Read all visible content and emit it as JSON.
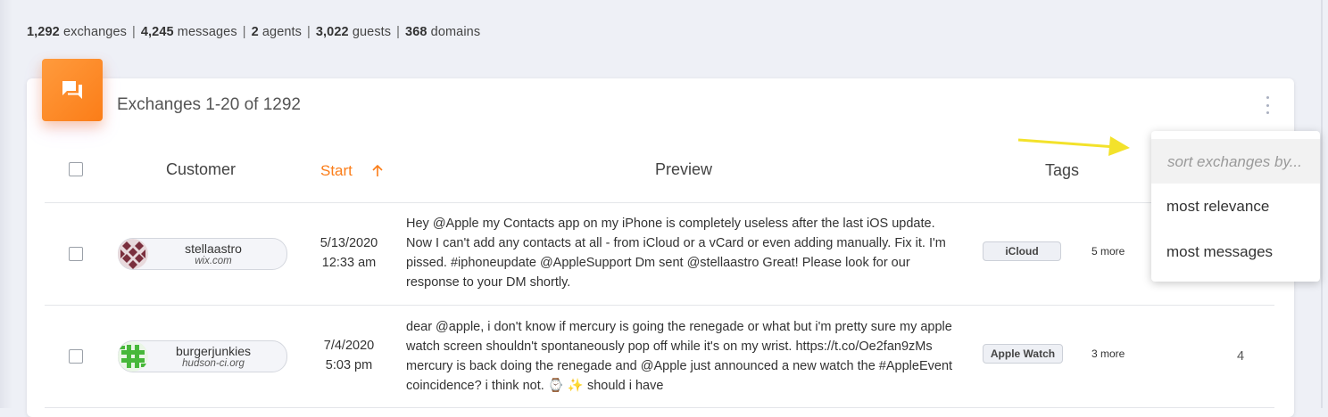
{
  "stats": {
    "exchanges_value": "1,292",
    "exchanges_label": "exchanges",
    "messages_value": "4,245",
    "messages_label": "messages",
    "agents_value": "2",
    "agents_label": "agents",
    "guests_value": "3,022",
    "guests_label": "guests",
    "domains_value": "368",
    "domains_label": "domains",
    "separator": "|"
  },
  "card": {
    "badge_icon": "chat-bubbles-icon",
    "title": "Exchanges 1-20 of 1292",
    "menu_icon": "kebab-menu-icon"
  },
  "table": {
    "headers": {
      "customer": "Customer",
      "start": "Start",
      "start_sort_icon": "arrow-up-icon",
      "preview": "Preview",
      "tags": "Tags"
    },
    "rows": [
      {
        "customer_name": "stellaastro",
        "customer_domain": "wix.com",
        "date": "5/13/2020",
        "time": "12:33 am",
        "preview": "Hey @Apple my Contacts app on my iPhone is completely useless after the last iOS update. Now I can't add any contacts at all - from iCloud or a vCard or even adding manually. Fix it. I'm pissed. #iphoneupdate @AppleSupport Dm sent @stellaastro Great! Please look for our response to your DM shortly.",
        "tag": "iCloud",
        "more": "5 more",
        "count": ""
      },
      {
        "customer_name": "burgerjunkies",
        "customer_domain": "hudson-ci.org",
        "date": "7/4/2020",
        "time": "5:03 pm",
        "preview": "dear @apple, i don't know if mercury is going the renegade or what but i'm pretty sure my apple watch screen shouldn't spontaneously pop off while it's on my wrist. https://t.co/Oe2fan9zMs mercury is back doing the renegade and @Apple just announced a new watch the #AppleEvent  coincidence? i think not. ⌚ ✨  should i have",
        "tag": "Apple Watch",
        "more": "3 more",
        "count": "4"
      }
    ]
  },
  "sort_menu": {
    "placeholder": "sort exchanges by...",
    "options": [
      "most relevance",
      "most messages"
    ]
  },
  "colors": {
    "accent": "#fb7d18",
    "annotation_arrow": "#f3e22b",
    "background": "#eef0f6"
  }
}
